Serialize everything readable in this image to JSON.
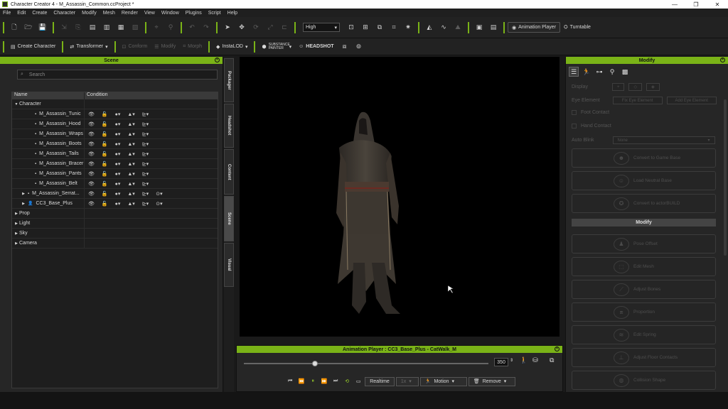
{
  "window": {
    "title": "Character Creator 4 - M_Assassin_Common.ccProject *",
    "minimize": "—",
    "maximize": "❐",
    "close": "✕"
  },
  "menu": [
    "File",
    "Edit",
    "Create",
    "Character",
    "Modify",
    "Mesh",
    "Render",
    "View",
    "Window",
    "Plugins",
    "Script",
    "Help"
  ],
  "toolbar1": {
    "quality": "High",
    "animation_player": "Animation Player",
    "turntable": "Turntable"
  },
  "toolbar2": {
    "create_character": "Create Character",
    "transformer": "Transformer",
    "conform": "Conform",
    "modify": "Modify",
    "morph": "Morph",
    "instalod": "InstaLOD",
    "substance": "SUBSTANCE PAINTER",
    "headshot": "HEADSHOT"
  },
  "scene": {
    "title": "Scene",
    "search_placeholder": "Search",
    "col_name": "Name",
    "col_condition": "Condition",
    "items": [
      {
        "label": "Character",
        "level": 0,
        "expanded": true
      },
      {
        "label": "M_Assassin_Tunic",
        "level": 2
      },
      {
        "label": "M_Assassin_Hood",
        "level": 2
      },
      {
        "label": "M_Assassin_Wraps",
        "level": 2
      },
      {
        "label": "M_Assassin_Boots",
        "level": 2
      },
      {
        "label": "M_Assassin_Tails",
        "level": 2
      },
      {
        "label": "M_Assassin_Bracer",
        "level": 2
      },
      {
        "label": "M_Assassin_Pants",
        "level": 2
      },
      {
        "label": "M_Assassin_Belt",
        "level": 2
      },
      {
        "label": "M_Assassin_Serrat...",
        "level": 1
      },
      {
        "label": "CC3_Base_Plus",
        "level": 1
      },
      {
        "label": "Prop",
        "level": 0
      },
      {
        "label": "Light",
        "level": 0
      },
      {
        "label": "Sky",
        "level": 0
      },
      {
        "label": "Camera",
        "level": 0
      }
    ]
  },
  "side_tabs": [
    "Packager",
    "Headshot",
    "Content",
    "Scene",
    "Visual"
  ],
  "animation_player": {
    "title": "Animation Player : CC3_Base_Plus - CatWalk_M",
    "frame": "350",
    "realtime": "Realtime",
    "fps": "1x",
    "motion": "Motion",
    "remove": "Remove",
    "progress": 0.29
  },
  "modify": {
    "title": "Modify",
    "display_label": "Display",
    "eye_element_label": "Eye Element",
    "fix_eye_element": "Fix Eye Element",
    "add_eye_element": "Add Eye Element",
    "foot_contact": "Foot Contact",
    "hand_contact": "Hand Contact",
    "auto_blink_label": "Auto Blink",
    "auto_blink_value": "None",
    "convert_game_base": "Convert to Game Base",
    "load_neutral_base": "Load Neutral Base",
    "convert_actorbuild": "Convert to actorBUILD",
    "section": "Modify",
    "pose_offset": "Pose Offset",
    "edit_mesh": "Edit Mesh",
    "adjust_bones": "Adjust Bones",
    "proportion": "Proportion",
    "edit_spring": "Edit Spring",
    "adjust_floor_contacts": "Adjust Floor Contacts",
    "collision_shape": "Collision Shape"
  },
  "colors": {
    "accent": "#7ab317",
    "panel": "#262626",
    "viewport": "#000000"
  }
}
